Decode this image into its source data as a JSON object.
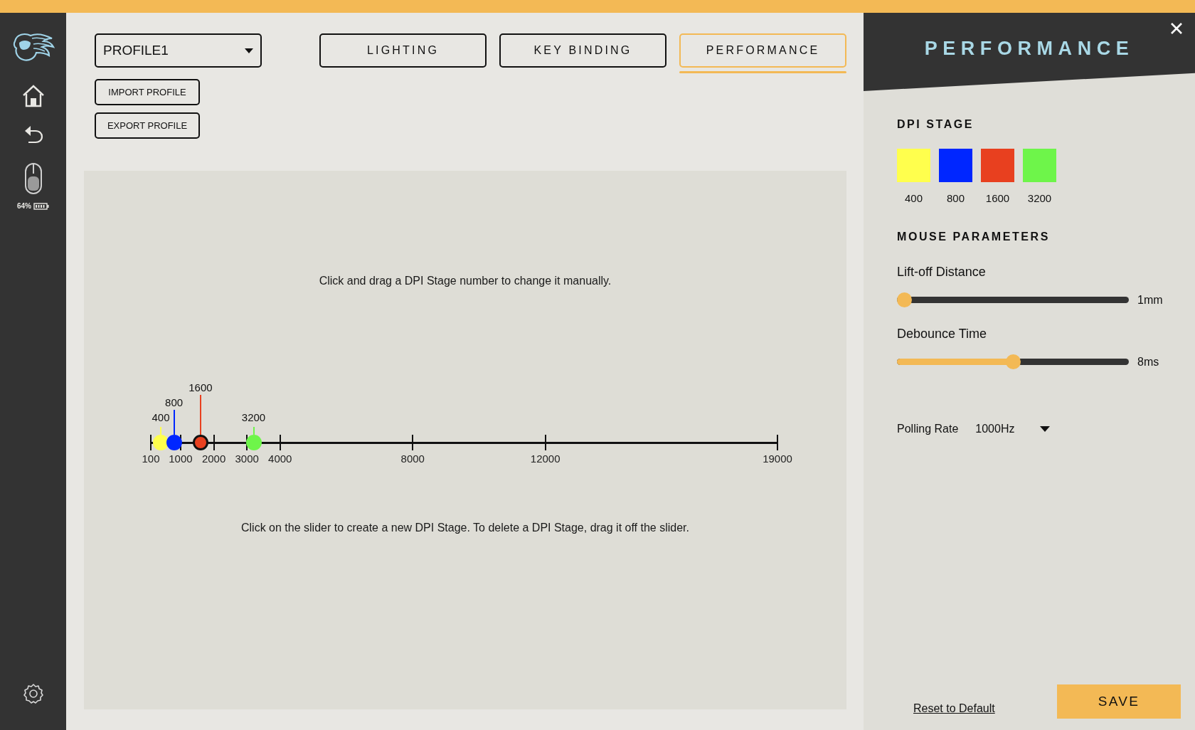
{
  "sidebar": {
    "battery": "64%"
  },
  "profile_select": {
    "value": "PROFILE1"
  },
  "profile_buttons": [
    "IMPORT PROFILE",
    "EXPORT PROFILE"
  ],
  "tabs": [
    {
      "label": "LIGHTING",
      "selected": false
    },
    {
      "label": "KEY BINDING",
      "selected": false
    },
    {
      "label": "PERFORMANCE",
      "selected": true
    }
  ],
  "dpi_editor": {
    "hint_top": "Click and drag a DPI Stage number to change it manually.",
    "ticks": [
      "100",
      "1000",
      "2000",
      "3000",
      "4000",
      "8000",
      "12000",
      "19000"
    ],
    "stages": [
      {
        "label": "400",
        "color": "#ffff4d",
        "selected": false
      },
      {
        "label": "800",
        "color": "#0026ff",
        "selected": false
      },
      {
        "label": "1600",
        "color": "#e8401f",
        "selected": true
      },
      {
        "label": "3200",
        "color": "#6ef54a",
        "selected": false
      }
    ],
    "hint_bottom": "Click on the slider to create a new DPI Stage. To delete a DPI Stage, drag it off the slider."
  },
  "panel": {
    "title": "PERFORMANCE",
    "dpi_heading": "DPI STAGE",
    "swatches": [
      {
        "label": "400",
        "color": "#ffff4d"
      },
      {
        "label": "800",
        "color": "#0026ff"
      },
      {
        "label": "1600",
        "color": "#e8401f"
      },
      {
        "label": "3200",
        "color": "#6ef54a"
      }
    ],
    "params_heading": "MOUSE PARAMETERS",
    "sliders": [
      {
        "label": "Lift-off Distance",
        "level": 0,
        "reading": "1mm"
      },
      {
        "label": "Debounce Time",
        "level": 0.5,
        "reading": "8ms"
      }
    ],
    "polling": {
      "label": "Polling Rate",
      "value": "1000Hz"
    },
    "reset_link": "Reset to Default",
    "save_button": "SAVE"
  }
}
